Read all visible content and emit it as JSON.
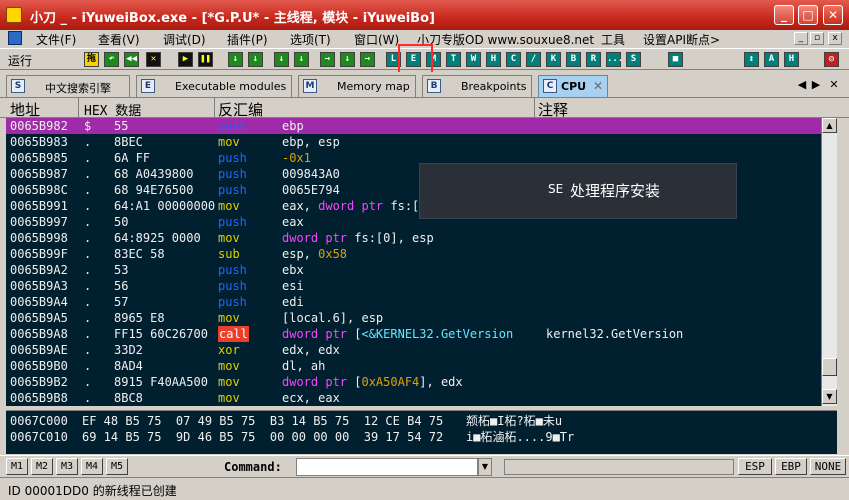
{
  "window": {
    "title": "小刀 _ - iYuweiBox.exe - [*G.P.U* - 主线程, 模块 - iYuweiBo]"
  },
  "menu": {
    "items": [
      "文件(F)",
      "查看(V)",
      "调试(D)",
      "插件(P)",
      "选项(T)",
      "窗口(W)",
      "小刀专版OD www.souxue8.net",
      "工具",
      "设置API断点>"
    ]
  },
  "toolbar": {
    "run_label": "运行",
    "buttons": [
      "拖",
      "↶",
      "◀◀",
      "✕",
      "▶",
      "❚❚",
      "↓",
      "↓",
      "↓",
      "↓",
      "→",
      "↓",
      "→",
      "L",
      "E",
      "M",
      "T",
      "W",
      "H",
      "C",
      "/",
      "K",
      "B",
      "R",
      "...",
      "S",
      "■",
      "↕",
      "A",
      "H",
      "◎"
    ]
  },
  "tabs": [
    {
      "icon": "S",
      "label": "中文搜索引擎",
      "active": false
    },
    {
      "icon": "E",
      "label": "Executable modules",
      "active": false
    },
    {
      "icon": "M",
      "label": "Memory map",
      "active": false
    },
    {
      "icon": "B",
      "label": "Breakpoints",
      "active": false
    },
    {
      "icon": "C",
      "label": "CPU",
      "active": true
    }
  ],
  "columns": {
    "address": "地址",
    "hex": "HEX 数据",
    "disasm": "反汇编",
    "comment": "注释"
  },
  "disasm_rows": [
    {
      "addr": "0065B982",
      "mark": "$",
      "hex": "55",
      "mnem": "push",
      "ops": "ebp",
      "selected": true
    },
    {
      "addr": "0065B983",
      "mark": ".",
      "hex": "8BEC",
      "mnem": "mov",
      "ops": "ebp, esp"
    },
    {
      "addr": "0065B985",
      "mark": ".",
      "hex": "6A FF",
      "mnem": "push",
      "ops": "-0x1"
    },
    {
      "addr": "0065B987",
      "mark": ".",
      "hex": "68 A0439800",
      "mnem": "push",
      "ops": "009843A0"
    },
    {
      "addr": "0065B98C",
      "mark": ".",
      "hex": "68 94E76500",
      "mnem": "push",
      "ops": "0065E794"
    },
    {
      "addr": "0065B991",
      "mark": ".",
      "hex": "64:A1 00000000",
      "mnem": "mov",
      "ops": "eax, dword ptr fs:[0]"
    },
    {
      "addr": "0065B997",
      "mark": ".",
      "hex": "50",
      "mnem": "push",
      "ops": "eax"
    },
    {
      "addr": "0065B998",
      "mark": ".",
      "hex": "64:8925 0000",
      "mnem": "mov",
      "ops": "dword ptr fs:[0], esp"
    },
    {
      "addr": "0065B99F",
      "mark": ".",
      "hex": "83EC 58",
      "mnem": "sub",
      "ops": "esp, 0x58"
    },
    {
      "addr": "0065B9A2",
      "mark": ".",
      "hex": "53",
      "mnem": "push",
      "ops": "ebx"
    },
    {
      "addr": "0065B9A3",
      "mark": ".",
      "hex": "56",
      "mnem": "push",
      "ops": "esi"
    },
    {
      "addr": "0065B9A4",
      "mark": ".",
      "hex": "57",
      "mnem": "push",
      "ops": "edi"
    },
    {
      "addr": "0065B9A5",
      "mark": ".",
      "hex": "8965 E8",
      "mnem": "mov",
      "ops": "[local.6], esp"
    },
    {
      "addr": "0065B9A8",
      "mark": ".",
      "hex": "FF15 60C26700",
      "mnem": "call",
      "ops": "dword ptr [<&KERNEL32.GetVersion",
      "comment": "kernel32.GetVersion"
    },
    {
      "addr": "0065B9AE",
      "mark": ".",
      "hex": "33D2",
      "mnem": "xor",
      "ops": "edx, edx"
    },
    {
      "addr": "0065B9B0",
      "mark": ".",
      "hex": "8AD4",
      "mnem": "mov",
      "ops": "dl, ah"
    },
    {
      "addr": "0065B9B2",
      "mark": ".",
      "hex": "8915 F40AA500",
      "mnem": "mov",
      "ops": "dword ptr [0xA50AF4], edx"
    },
    {
      "addr": "0065B9B8",
      "mark": ".",
      "hex": "8BC8",
      "mnem": "mov",
      "ops": "ecx, eax"
    }
  ],
  "overlay": {
    "se_label": "SE",
    "text": "处理程序安装"
  },
  "dump_rows": [
    {
      "addr": "0067C000",
      "hex": "EF 48 B5 75  07 49 B5 75  B3 14 B5 75  12 CE B4 75",
      "ascii": "颒柘■I柘?柘■未u"
    },
    {
      "addr": "0067C010",
      "hex": "69 14 B5 75  9D 46 B5 75  00 00 00 00  39 17 54 72",
      "ascii": "i■柘滷柘....9■Tr"
    }
  ],
  "bottom": {
    "m_buttons": [
      "M1",
      "M2",
      "M3",
      "M4",
      "M5"
    ],
    "command_label": "Command:",
    "reg_buttons": [
      "ESP",
      "EBP",
      "NONE"
    ]
  },
  "status": {
    "text": "ID 00001DD0 的新线程已创建"
  },
  "colors": {
    "title_bar": "#c8281c",
    "pane_bg": "#002030",
    "selection": "#9f2ba8",
    "mnemonic_push": "#1e64ff",
    "mnemonic_mov": "#e0d000",
    "call_bg": "#e8402a",
    "highlight_box": "#ff2a2a"
  }
}
